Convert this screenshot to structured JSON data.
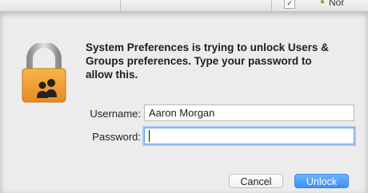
{
  "background_window": {
    "checkbox_mark": "✓",
    "item_glyph": "●",
    "item_text": "Nor"
  },
  "dialog": {
    "message": "System Preferences is trying to unlock Users & Groups preferences. Type your password to allow this.",
    "icon": "padlock-users-icon",
    "username": {
      "label": "Username:",
      "value": "Aaron Morgan"
    },
    "password": {
      "label": "Password:",
      "value": ""
    },
    "buttons": {
      "cancel_label": "Cancel",
      "unlock_label": "Unlock"
    }
  },
  "colors": {
    "accent": "#3d8ef7",
    "lock_gold": "#f2a23a",
    "focus_ring": "#a9c8f4"
  }
}
